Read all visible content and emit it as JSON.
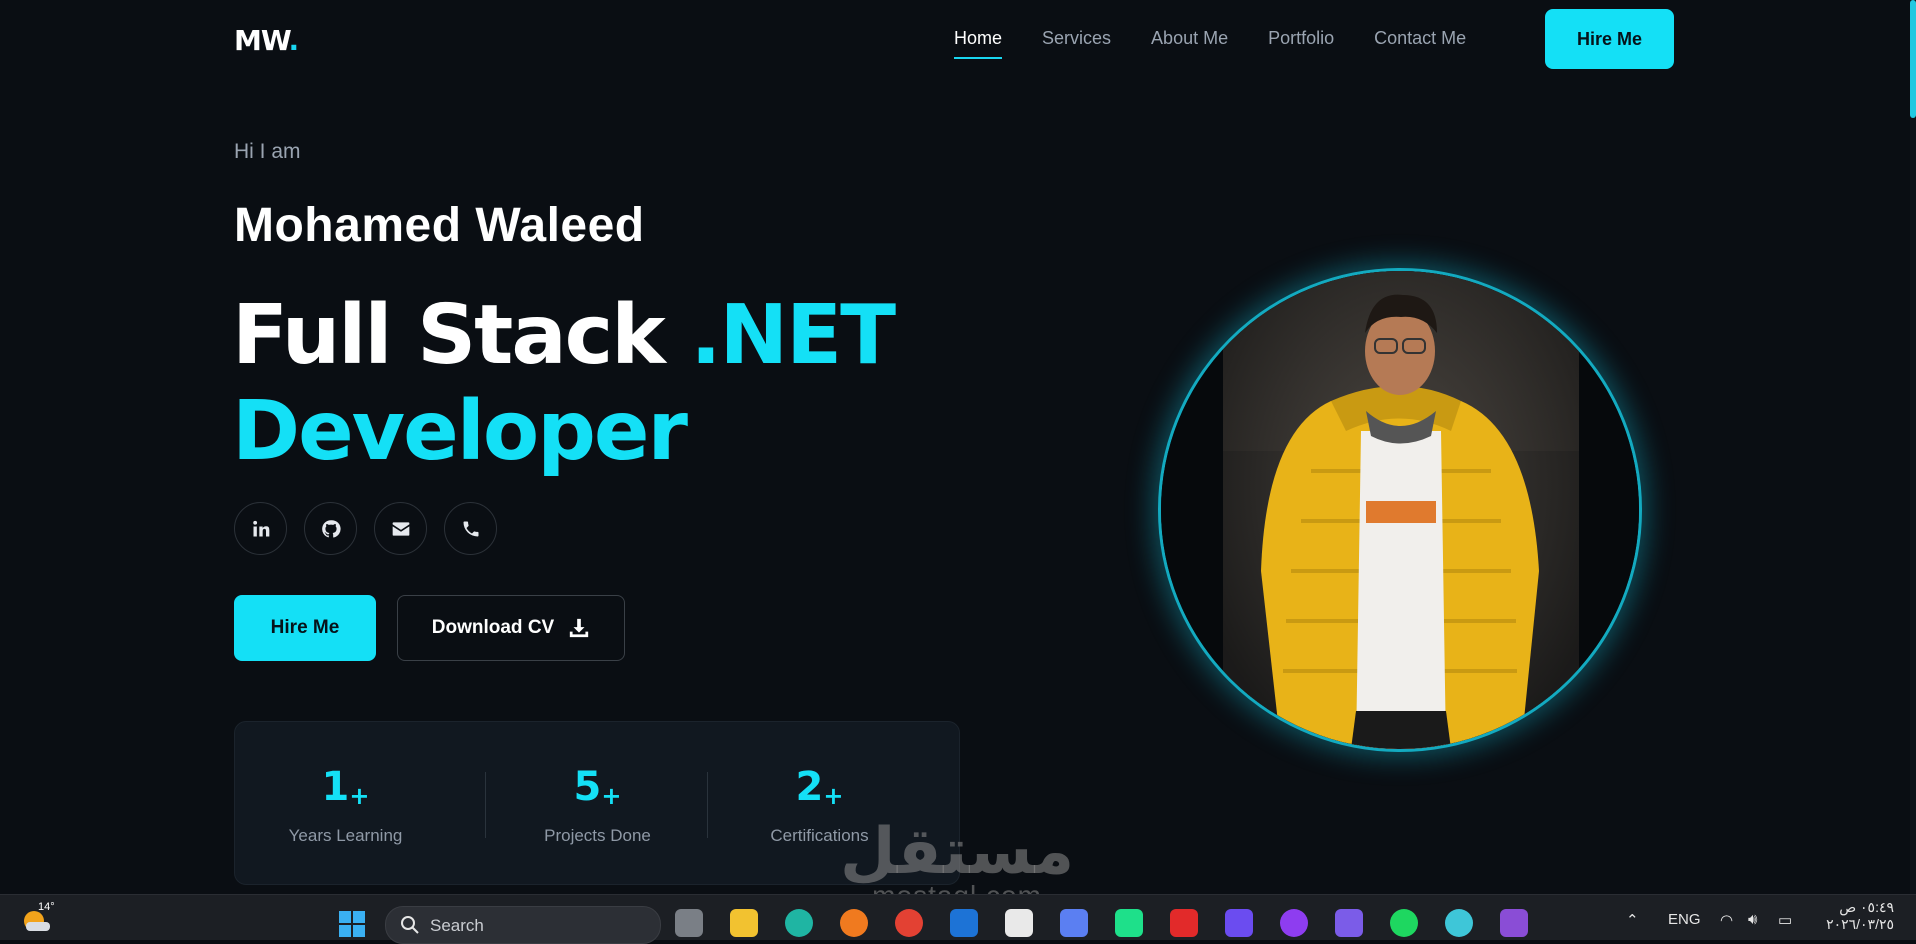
{
  "nav": {
    "logo_main": "MW",
    "logo_dot": ".",
    "items": [
      {
        "label": "Home",
        "active": true
      },
      {
        "label": "Services",
        "active": false
      },
      {
        "label": "About Me",
        "active": false
      },
      {
        "label": "Portfolio",
        "active": false
      },
      {
        "label": "Contact Me",
        "active": false
      }
    ],
    "hire_label": "Hire Me"
  },
  "hero": {
    "greeting": "Hi I am",
    "name": "Mohamed Waleed",
    "title_white": "Full Stack ",
    "title_cyan_1": ".NET",
    "title_cyan_2": "Developer",
    "socials": [
      "linkedin-icon",
      "github-icon",
      "email-icon",
      "phone-icon"
    ],
    "hire_label": "Hire Me",
    "cv_label": "Download CV"
  },
  "stats": [
    {
      "value": "1",
      "suffix": "+",
      "label": "Years Learning"
    },
    {
      "value": "5",
      "suffix": "+",
      "label": "Projects Done"
    },
    {
      "value": "2",
      "suffix": "+",
      "label": "Certifications"
    }
  ],
  "watermark": {
    "arabic": "مستقل",
    "latin": "mostaql.com"
  },
  "taskbar": {
    "temperature": "14°",
    "search_placeholder": "Search",
    "language": "ENG",
    "time": "٠٥:٤٩ ص",
    "date": "٢٠٢٦/٠٣/٢٥"
  },
  "colors": {
    "accent": "#14e0f6",
    "background": "#0a0e13"
  }
}
